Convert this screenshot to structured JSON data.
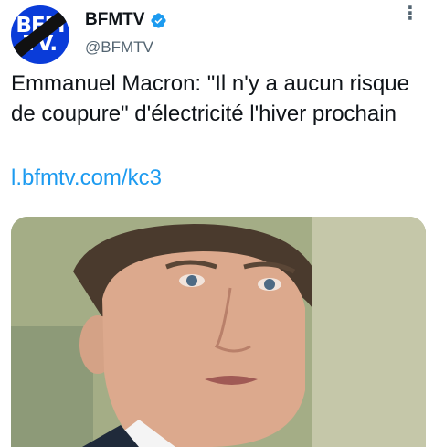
{
  "account": {
    "avatar_logo_line1": "BFM",
    "avatar_logo_line2": "TV.",
    "display_name": "BFMTV",
    "handle": "@BFMTV",
    "verified": true
  },
  "tweet": {
    "text": "Emmanuel Macron: \"Il n'y a aucun risque de coupure\" d'électricité l'hiver prochain",
    "link": "l.bfmtv.com/kc3"
  },
  "icons": {
    "verified": "verified-badge-icon",
    "more": "more-options-icon"
  },
  "colors": {
    "brand_blue": "#0a3cd9",
    "link_blue": "#1d9bf0",
    "text": "#0f1419",
    "secondary_text": "#536471"
  }
}
